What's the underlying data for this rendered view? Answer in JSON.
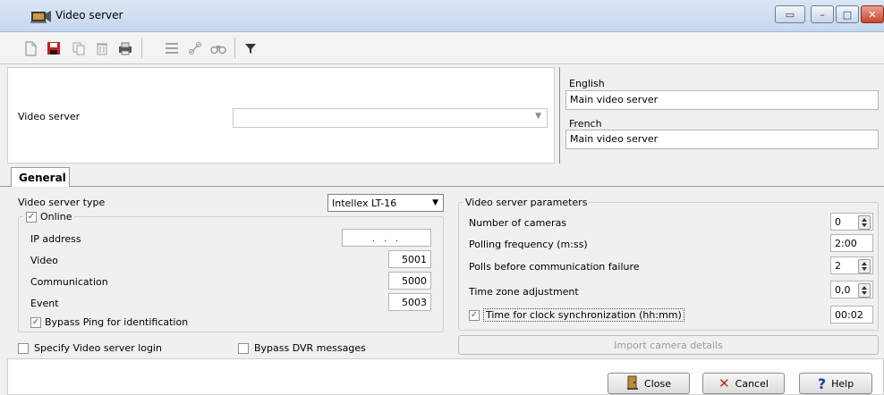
{
  "window": {
    "title": "Video server",
    "controls": {
      "restore": "▭",
      "minimize": "–",
      "maximize": "□",
      "close": "✕"
    }
  },
  "toolbar": {
    "icons": [
      "new-icon",
      "save-icon",
      "copy-icon",
      "delete-icon",
      "print-icon",
      "list-icon",
      "link-icon",
      "find-icon",
      "filter-icon"
    ]
  },
  "header": {
    "video_server_label": "Video server",
    "video_server_value": "",
    "english_label": "English",
    "english_value": "Main video server",
    "french_label": "French",
    "french_value": "Main video server"
  },
  "tabs": [
    {
      "label": "General"
    }
  ],
  "general": {
    "type_label": "Video server type",
    "type_value": "Intellex LT-16",
    "online_label": "Online",
    "online_checked": true,
    "ip_label": "IP address",
    "ip_value": ". . .",
    "video_label": "Video",
    "video_value": "5001",
    "communication_label": "Communication",
    "communication_value": "5000",
    "event_label": "Event",
    "event_value": "5003",
    "bypass_ping_label": "Bypass Ping for identification",
    "bypass_ping_checked": true,
    "specify_login_label": "Specify Video server login",
    "specify_login_checked": false,
    "bypass_dvr_label": "Bypass DVR messages",
    "bypass_dvr_checked": false
  },
  "parameters": {
    "group_label": "Video server parameters",
    "cameras_label": "Number of cameras",
    "cameras_value": "0",
    "polling_label": "Polling frequency (m:ss)",
    "polling_value": "2:00",
    "polls_label": "Polls before communication failure",
    "polls_value": "2",
    "tz_label": "Time zone adjustment",
    "tz_value": "0,0",
    "clock_label": "Time for clock synchronization (hh:mm)",
    "clock_checked": true,
    "clock_value": "00:02",
    "import_label": "Import camera details"
  },
  "footer": {
    "close_label": "Close",
    "cancel_label": "Cancel",
    "help_label": "Help"
  },
  "colors": {
    "title_bar": "#c6d7ee",
    "check": "#2a5fb3",
    "cancel_x": "#c0281c",
    "help_q": "#1a3fa3"
  }
}
